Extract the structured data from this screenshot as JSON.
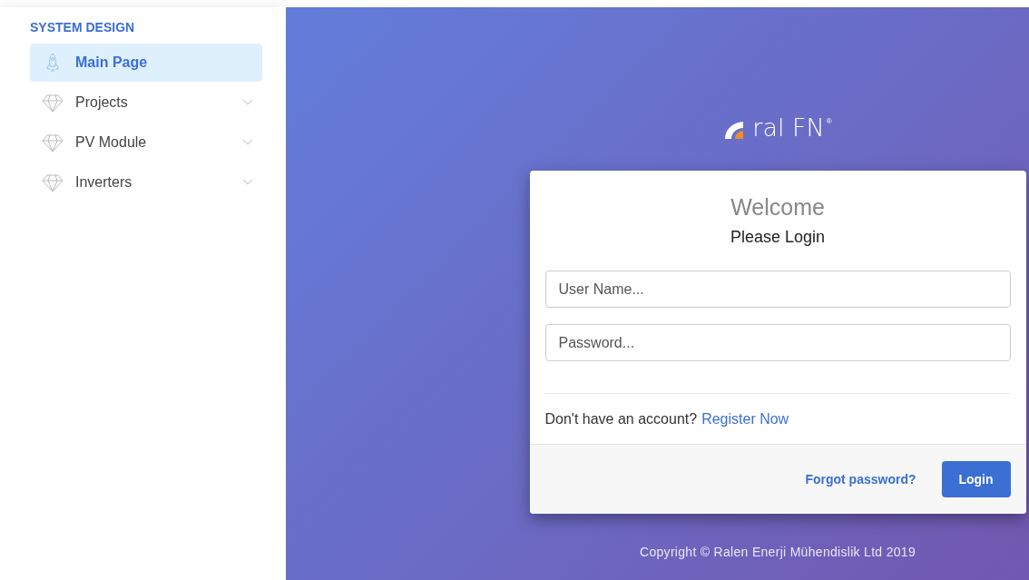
{
  "sidebar": {
    "heading": "SYSTEM DESIGN",
    "items": [
      {
        "label": "Main Page",
        "kind": "rocket",
        "selected": true,
        "expandable": false
      },
      {
        "label": "Projects",
        "kind": "diamond",
        "selected": false,
        "expandable": true
      },
      {
        "label": "PV Module",
        "kind": "diamond",
        "selected": false,
        "expandable": true
      },
      {
        "label": "Inverters",
        "kind": "diamond",
        "selected": false,
        "expandable": true
      }
    ]
  },
  "logo": {
    "text": "ral FN",
    "mark": "®"
  },
  "login_card": {
    "title": "Welcome",
    "subtitle": "Please Login",
    "fields": [
      {
        "placeholder": "User Name..."
      },
      {
        "placeholder": "Password..."
      }
    ],
    "register_prompt": "Don't have an account?",
    "register_link": "Register Now",
    "forgot_link": "Forgot password?",
    "login_button": "Login"
  },
  "footer": "Copyright © Ralen Enerji Mühendislik Ltd 2019"
}
